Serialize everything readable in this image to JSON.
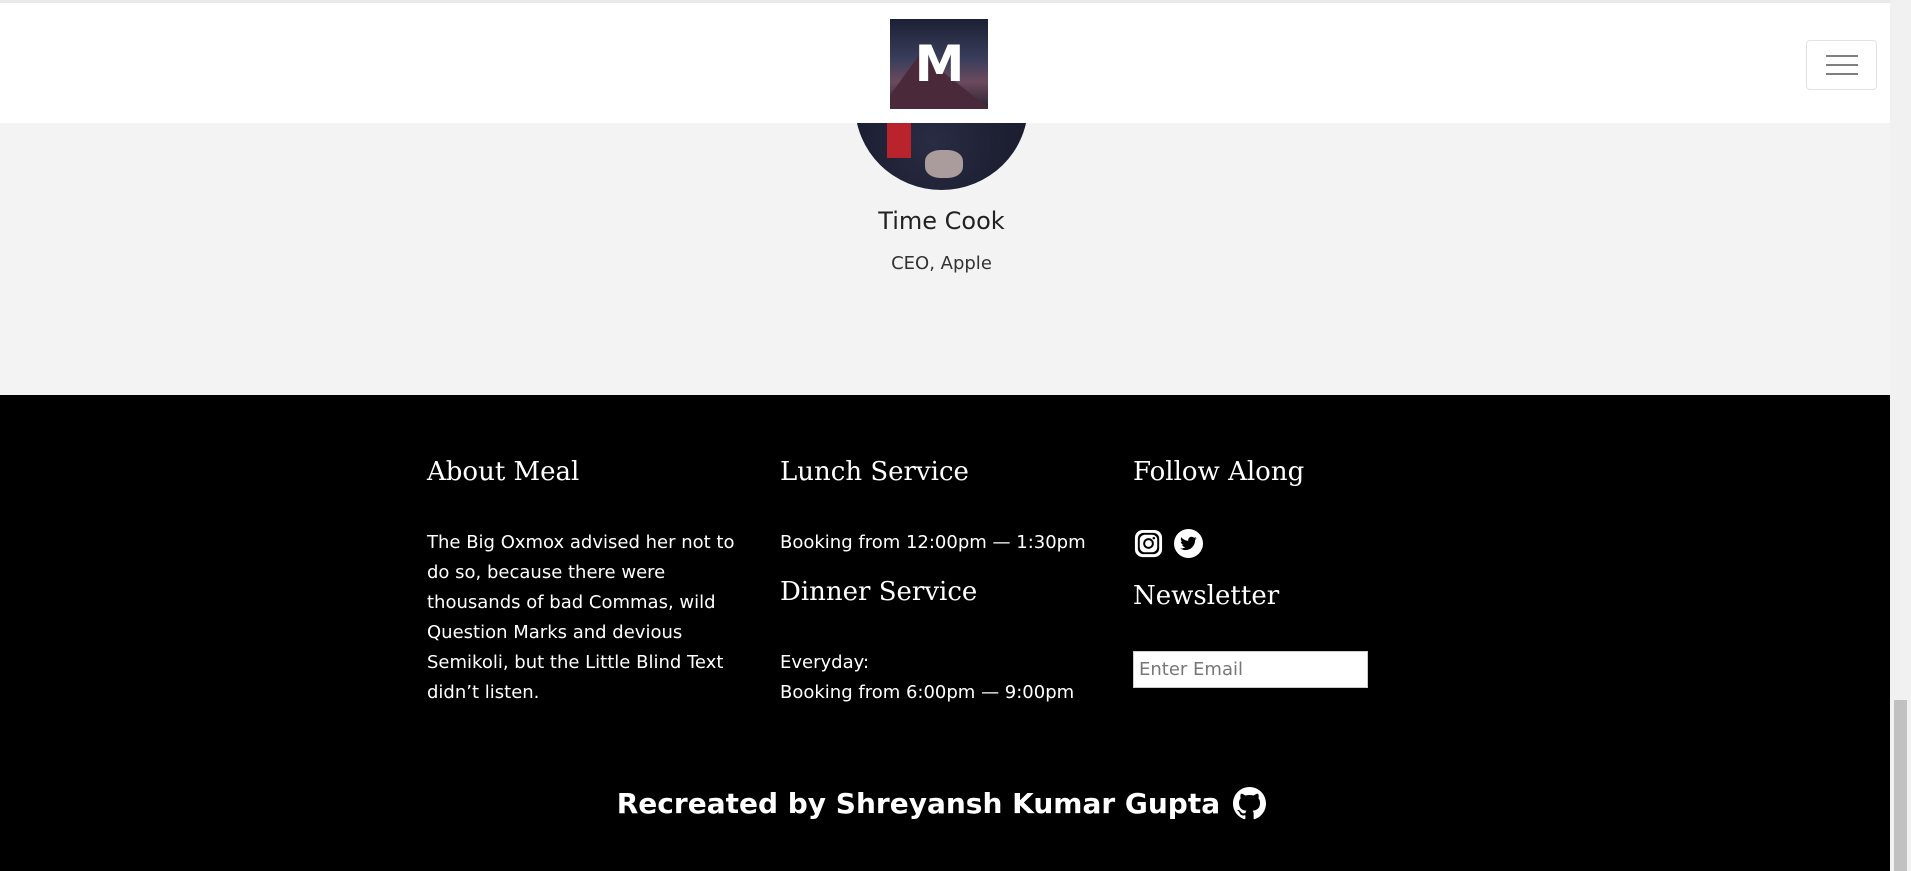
{
  "header": {
    "logo_letter": "M",
    "menu_label": "menu"
  },
  "testimonial": {
    "name": "Time Cook",
    "role": "CEO, Apple"
  },
  "footer": {
    "about": {
      "heading": "About Meal",
      "text": "The Big Oxmox advised her not to do so, because there were thousands of bad Commas, wild Question Marks and devious Semikoli, but the Little Blind Text didn’t listen."
    },
    "lunch": {
      "heading": "Lunch Service",
      "text": "Booking from 12:00pm — 1:30pm"
    },
    "dinner": {
      "heading": "Dinner Service",
      "line1": "Everyday:",
      "line2": "Booking from 6:00pm — 9:00pm"
    },
    "follow": {
      "heading": "Follow Along",
      "icons": [
        "instagram-icon",
        "twitter-icon"
      ]
    },
    "newsletter": {
      "heading": "Newsletter",
      "placeholder": "Enter Email"
    },
    "credit": {
      "text": "Recreated by Shreyansh Kumar Gupta",
      "icon": "github-icon"
    }
  },
  "colors": {
    "header_bg": "#ffffff",
    "testimonial_bg": "#f3f3f3",
    "footer_bg": "#000000",
    "footer_text": "#ffffff"
  }
}
